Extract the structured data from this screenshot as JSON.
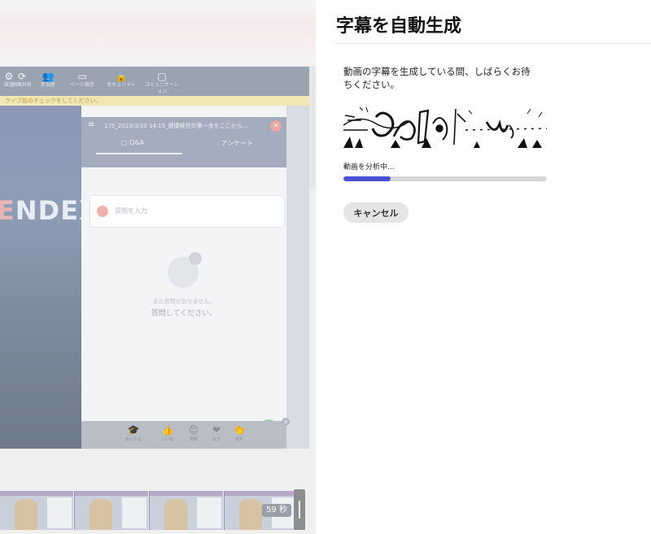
{
  "panel": {
    "title": "字幕を自動生成",
    "description": "動画の字幕を生成している間、しばらくお待ちください。",
    "status": "動画を分析中...",
    "progress_fraction": 0.23,
    "cancel_label": "キャンセル",
    "accent_color": "#4a4fd6"
  },
  "preview": {
    "toolbar": [
      {
        "label": "設定",
        "icon": "gear-icon"
      },
      {
        "label": "画面共有",
        "icon": "refresh-icon"
      },
      {
        "label": "参加者",
        "icon": "people-icon"
      },
      {
        "label": "ページ表示",
        "icon": "monitor-icon"
      },
      {
        "label": "セキュリティ",
        "icon": "lock-icon"
      },
      {
        "label": "コミュニケーション",
        "icon": "chat-icon"
      }
    ],
    "notice": "ライブ前のチェックをしてください。",
    "brand": "NDEX",
    "qa": {
      "title": "175_2023/3/10 14:15_健康経営の第一歩をここから...",
      "tab_qa": "Q&A",
      "tab_survey": "アンケート",
      "input_placeholder": "質問を入力",
      "empty_line1": "まだ質問がありません。",
      "empty_line2": "質問してください。"
    },
    "reactions": [
      {
        "label": "気になる",
        "emoji": "🎓"
      },
      {
        "label": "いいね",
        "emoji": "👍"
      },
      {
        "label": "笑顔",
        "emoji": "😊"
      },
      {
        "label": "好き",
        "emoji": "❤"
      },
      {
        "label": "拍手",
        "emoji": "👏"
      }
    ]
  },
  "timeline": {
    "duration": "59 秒"
  }
}
